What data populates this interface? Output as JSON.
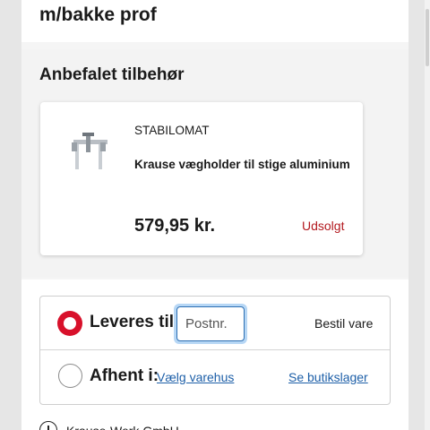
{
  "product": {
    "title_line2": "m/bakke prof"
  },
  "accessories": {
    "heading": "Anbefalet tilbehør",
    "items": [
      {
        "brand": "STABILOMAT",
        "name": "Krause vægholder til stige aluminium",
        "price": "579,95 kr.",
        "status": "Udsolgt",
        "image_icon": "wall-bracket-image"
      }
    ]
  },
  "delivery": {
    "deliver_label": "Leveres til:",
    "postcode_placeholder": "Postnr.",
    "postcode_value": "",
    "order_label": "Bestil vare",
    "pickup_label": "Afhent i:",
    "choose_store_label": "Vælg varehus",
    "see_stock_label": "Se butikslager",
    "selected_option": "deliver"
  },
  "supplier": {
    "name": "Krause-Werk GmbH"
  },
  "colors": {
    "accent_red": "#d8112b",
    "sold_out_red": "#b3191f",
    "link_blue": "#1d5fa8",
    "focus_blue": "#2c6fb3"
  }
}
